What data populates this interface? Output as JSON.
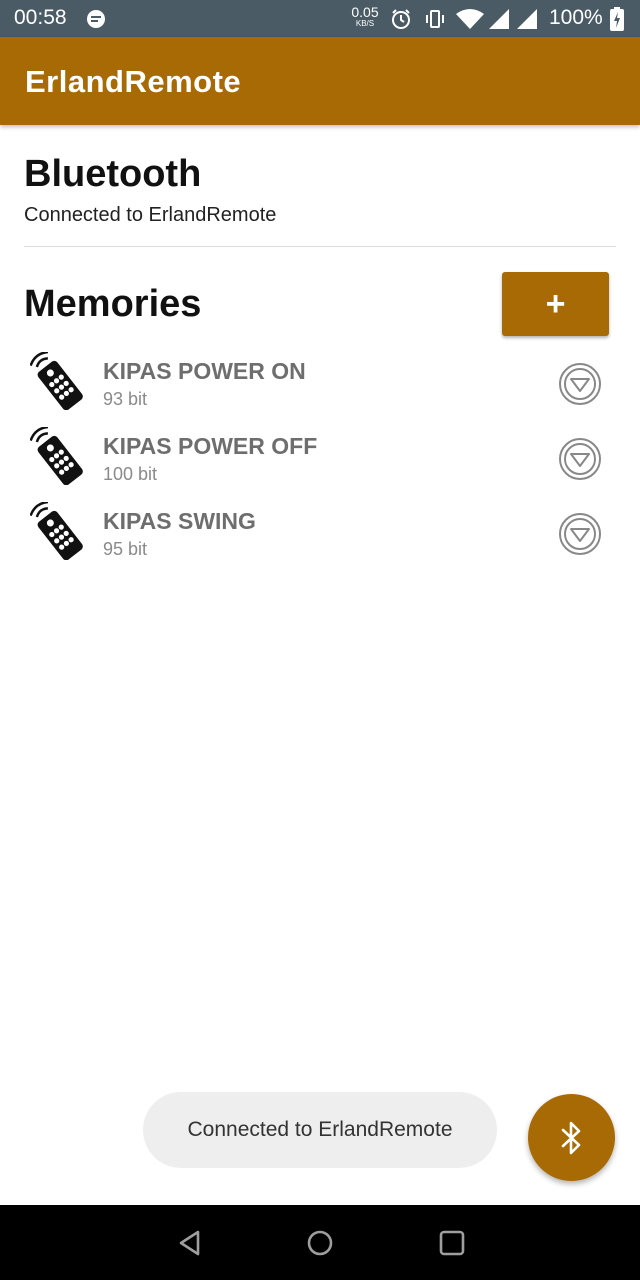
{
  "status_bar": {
    "time": "00:58",
    "speed_value": "0.05",
    "speed_unit": "KB/S",
    "battery": "100%"
  },
  "app_bar": {
    "title": "ErlandRemote"
  },
  "bluetooth": {
    "title": "Bluetooth",
    "status": "Connected to ErlandRemote"
  },
  "memories": {
    "title": "Memories",
    "add_label": "+",
    "items": [
      {
        "name": "KIPAS POWER ON",
        "bits": "93 bit"
      },
      {
        "name": "KIPAS POWER OFF",
        "bits": "100 bit"
      },
      {
        "name": "KIPAS SWING",
        "bits": "95 bit"
      }
    ]
  },
  "toast": {
    "message": "Connected to ErlandRemote"
  },
  "colors": {
    "accent": "#a86a04",
    "status_bar": "#4a5b66"
  },
  "icons": {
    "fab": "bluetooth-icon",
    "item_icon": "remote-control-icon",
    "item_action": "send-icon"
  }
}
